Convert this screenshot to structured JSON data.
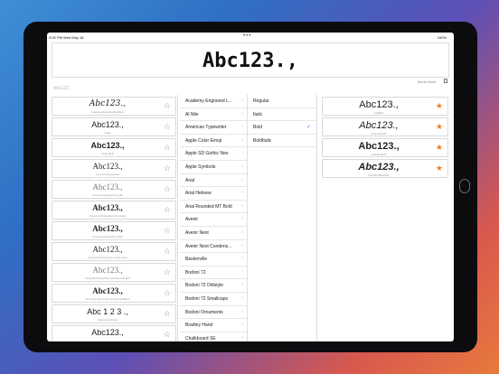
{
  "status": {
    "time": "9:00 PM  Wed May 18",
    "dots": "•••",
    "battery": "100%"
  },
  "preview": {
    "text": "Abc123.,"
  },
  "meta": {
    "font_name": "Menlo-Bold"
  },
  "search": {
    "placeholder": "Abc123."
  },
  "fonts": [
    {
      "sample": "Abc123.,",
      "label": "AcademyEngravedLetPlain"
    },
    {
      "sample": "Abc123.,",
      "label": "ANile"
    },
    {
      "sample": "Abc123.,",
      "label": "ANile-Bold"
    },
    {
      "sample": "Abc123.,",
      "label": "AmericanTypewriter"
    },
    {
      "sample": "Abc123.,",
      "label": "AmericanTypewriter-Light"
    },
    {
      "sample": "Abc123.,",
      "label": "AmericanTypewriter-Semibold"
    },
    {
      "sample": "Abc123.,",
      "label": "AmericanTypewriter-Bold"
    },
    {
      "sample": "Abc123.,",
      "label": "AmericanTypewriter-Condensed"
    },
    {
      "sample": "Abc123.,",
      "label": "AmericanTypewriter-CondensedLight"
    },
    {
      "sample": "Abc123.,",
      "label": "AmericanTypewriter-CondensedBold"
    },
    {
      "sample": "Abc 1 2 3 .,",
      "label": "AppleColorEmoji"
    },
    {
      "sample": "Abc123.,",
      "label": ""
    }
  ],
  "families": [
    "Academy Engraved L...",
    "Al Nile",
    "American Typewriter",
    "Apple Color Emoji",
    "Apple SD Gothic Neo",
    "Apple Symbols",
    "Arial",
    "Arial Hebrew",
    "Arial Rounded MT Bold",
    "Avenir",
    "Avenir Next",
    "Avenir Next Condens...",
    "Baskerville",
    "Bodoni 72",
    "Bodoni 72 Oldstyle",
    "Bodoni 72 Smallcaps",
    "Bodoni Ornaments",
    "Bradley Hand",
    "Chalkboard SE"
  ],
  "styles": [
    "Regular",
    "Italic",
    "Bold",
    "BoldItalic"
  ],
  "selected_style": "Bold",
  "favorites": [
    {
      "sample": "Abc123.,",
      "label": "ArialMT"
    },
    {
      "sample": "Abc123.,",
      "label": "Arial-ItalicMT"
    },
    {
      "sample": "Abc123.,",
      "label": "Arial-BoldMT"
    },
    {
      "sample": "Abc123.,",
      "label": "Arial-BoldItalicMT"
    }
  ],
  "icons": {
    "star": "star-icon",
    "star_filled": "star-filled-icon",
    "chevron": "chevron-right-icon",
    "check": "checkmark-icon",
    "copy": "copy-icon"
  },
  "colors": {
    "accent": "#2f7cf6",
    "favorite_star": "#ef7d24"
  }
}
